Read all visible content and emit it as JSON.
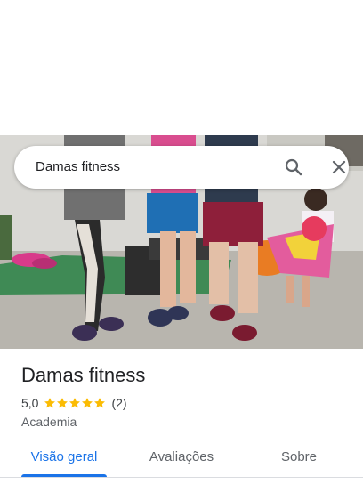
{
  "search": {
    "query": "Damas fitness"
  },
  "place": {
    "title": "Damas fitness",
    "rating": "5,0",
    "stars": 5,
    "review_count": "(2)",
    "category": "Academia"
  },
  "tabs": [
    {
      "label": "Visão geral",
      "active": true
    },
    {
      "label": "Avaliações",
      "active": false
    },
    {
      "label": "Sobre",
      "active": false
    }
  ],
  "colors": {
    "accent": "#1a73e8",
    "star": "#fbbc04"
  },
  "icons": {
    "search": "search-icon",
    "close": "close-icon",
    "star": "star-icon"
  }
}
